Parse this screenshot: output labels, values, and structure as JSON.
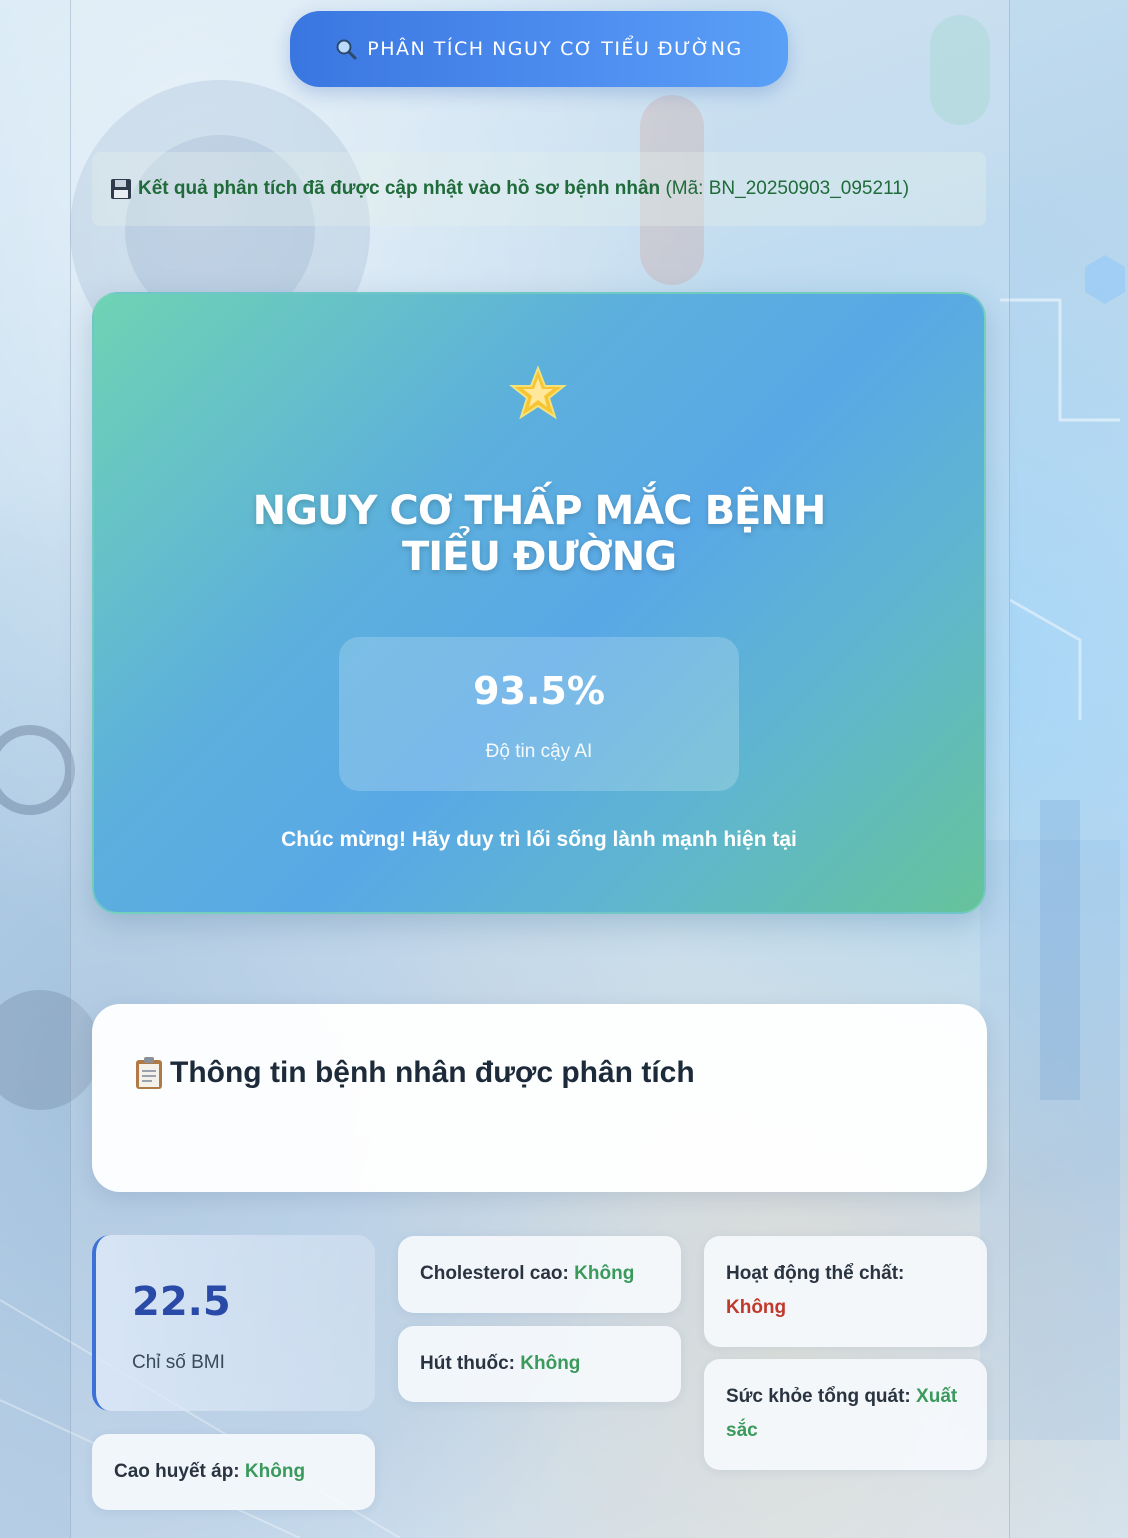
{
  "actions": {
    "analyze_label": "PHÂN TÍCH NGUY CƠ TIỂU ĐƯỜNG"
  },
  "save_notice": {
    "text": "Kết quả phân tích đã được cập nhật vào hồ sơ bệnh nhân",
    "code_text": "(Mã: BN_20250903_095211)"
  },
  "result": {
    "title": "NGUY CƠ THẤP MẮC BỆNH TIỂU ĐƯỜNG",
    "confidence_value": "93.5%",
    "confidence_label": "Độ tin cậy AI",
    "message": "Chúc mừng! Hãy duy trì lối sống lành mạnh hiện tại"
  },
  "patient": {
    "section_title": "Thông tin bệnh nhân được phân tích",
    "bmi_value": "22.5",
    "bmi_label": "Chỉ số BMI",
    "high_bp_label": "Cao huyết áp:",
    "high_bp_value": "Không",
    "cholesterol_label": "Cholesterol cao:",
    "cholesterol_value": "Không",
    "smoking_label": "Hút thuốc:",
    "smoking_value": "Không",
    "activity_label": "Hoạt động thể chất:",
    "activity_value": "Không",
    "health_label": "Sức khỏe tổng quát:",
    "health_value": "Xuất sắc"
  },
  "colors": {
    "accent": "#3c72d8",
    "positive": "#3a9a5c",
    "negative": "#c0392b",
    "save_text": "#1f6b3a"
  },
  "icons": {
    "analyze": "search-icon",
    "save": "floppy-disk-icon",
    "result": "star-icon",
    "patient": "clipboard-icon"
  }
}
